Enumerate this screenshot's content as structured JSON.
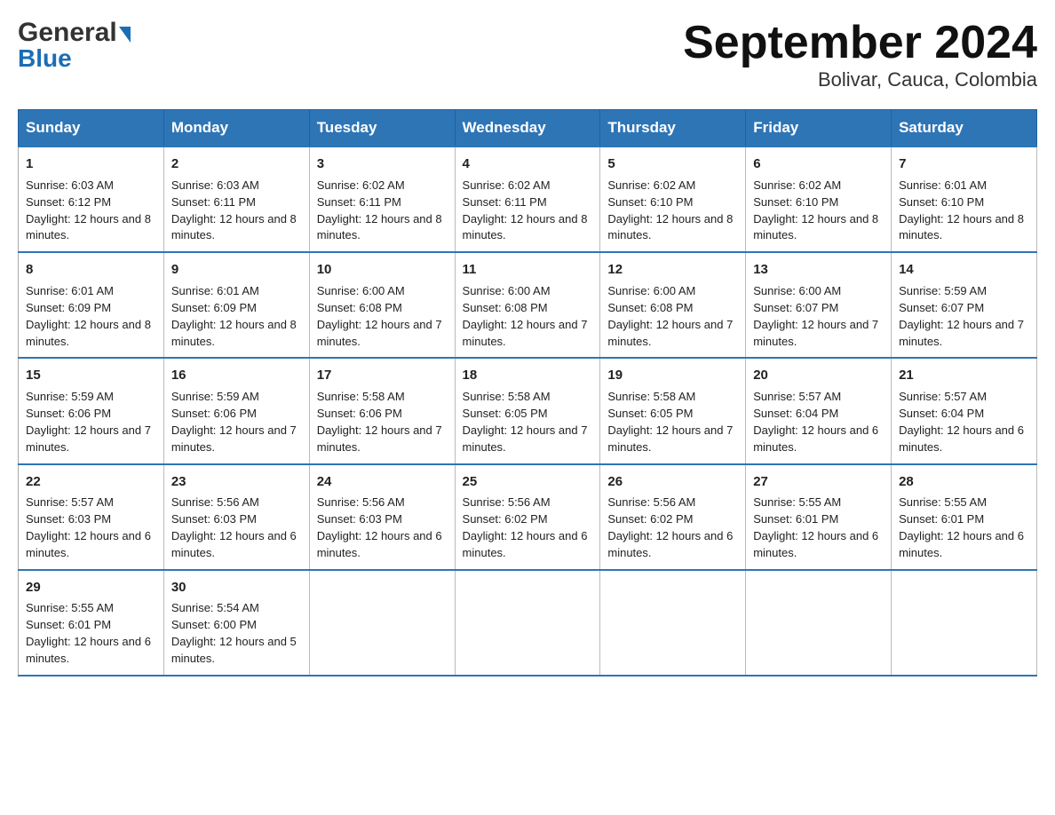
{
  "logo": {
    "general": "General",
    "blue": "Blue",
    "triangle": "▶"
  },
  "title": "September 2024",
  "subtitle": "Bolivar, Cauca, Colombia",
  "weekdays": [
    "Sunday",
    "Monday",
    "Tuesday",
    "Wednesday",
    "Thursday",
    "Friday",
    "Saturday"
  ],
  "weeks": [
    [
      {
        "day": "1",
        "sunrise": "6:03 AM",
        "sunset": "6:12 PM",
        "daylight": "12 hours and 8 minutes."
      },
      {
        "day": "2",
        "sunrise": "6:03 AM",
        "sunset": "6:11 PM",
        "daylight": "12 hours and 8 minutes."
      },
      {
        "day": "3",
        "sunrise": "6:02 AM",
        "sunset": "6:11 PM",
        "daylight": "12 hours and 8 minutes."
      },
      {
        "day": "4",
        "sunrise": "6:02 AM",
        "sunset": "6:11 PM",
        "daylight": "12 hours and 8 minutes."
      },
      {
        "day": "5",
        "sunrise": "6:02 AM",
        "sunset": "6:10 PM",
        "daylight": "12 hours and 8 minutes."
      },
      {
        "day": "6",
        "sunrise": "6:02 AM",
        "sunset": "6:10 PM",
        "daylight": "12 hours and 8 minutes."
      },
      {
        "day": "7",
        "sunrise": "6:01 AM",
        "sunset": "6:10 PM",
        "daylight": "12 hours and 8 minutes."
      }
    ],
    [
      {
        "day": "8",
        "sunrise": "6:01 AM",
        "sunset": "6:09 PM",
        "daylight": "12 hours and 8 minutes."
      },
      {
        "day": "9",
        "sunrise": "6:01 AM",
        "sunset": "6:09 PM",
        "daylight": "12 hours and 8 minutes."
      },
      {
        "day": "10",
        "sunrise": "6:00 AM",
        "sunset": "6:08 PM",
        "daylight": "12 hours and 7 minutes."
      },
      {
        "day": "11",
        "sunrise": "6:00 AM",
        "sunset": "6:08 PM",
        "daylight": "12 hours and 7 minutes."
      },
      {
        "day": "12",
        "sunrise": "6:00 AM",
        "sunset": "6:08 PM",
        "daylight": "12 hours and 7 minutes."
      },
      {
        "day": "13",
        "sunrise": "6:00 AM",
        "sunset": "6:07 PM",
        "daylight": "12 hours and 7 minutes."
      },
      {
        "day": "14",
        "sunrise": "5:59 AM",
        "sunset": "6:07 PM",
        "daylight": "12 hours and 7 minutes."
      }
    ],
    [
      {
        "day": "15",
        "sunrise": "5:59 AM",
        "sunset": "6:06 PM",
        "daylight": "12 hours and 7 minutes."
      },
      {
        "day": "16",
        "sunrise": "5:59 AM",
        "sunset": "6:06 PM",
        "daylight": "12 hours and 7 minutes."
      },
      {
        "day": "17",
        "sunrise": "5:58 AM",
        "sunset": "6:06 PM",
        "daylight": "12 hours and 7 minutes."
      },
      {
        "day": "18",
        "sunrise": "5:58 AM",
        "sunset": "6:05 PM",
        "daylight": "12 hours and 7 minutes."
      },
      {
        "day": "19",
        "sunrise": "5:58 AM",
        "sunset": "6:05 PM",
        "daylight": "12 hours and 7 minutes."
      },
      {
        "day": "20",
        "sunrise": "5:57 AM",
        "sunset": "6:04 PM",
        "daylight": "12 hours and 6 minutes."
      },
      {
        "day": "21",
        "sunrise": "5:57 AM",
        "sunset": "6:04 PM",
        "daylight": "12 hours and 6 minutes."
      }
    ],
    [
      {
        "day": "22",
        "sunrise": "5:57 AM",
        "sunset": "6:03 PM",
        "daylight": "12 hours and 6 minutes."
      },
      {
        "day": "23",
        "sunrise": "5:56 AM",
        "sunset": "6:03 PM",
        "daylight": "12 hours and 6 minutes."
      },
      {
        "day": "24",
        "sunrise": "5:56 AM",
        "sunset": "6:03 PM",
        "daylight": "12 hours and 6 minutes."
      },
      {
        "day": "25",
        "sunrise": "5:56 AM",
        "sunset": "6:02 PM",
        "daylight": "12 hours and 6 minutes."
      },
      {
        "day": "26",
        "sunrise": "5:56 AM",
        "sunset": "6:02 PM",
        "daylight": "12 hours and 6 minutes."
      },
      {
        "day": "27",
        "sunrise": "5:55 AM",
        "sunset": "6:01 PM",
        "daylight": "12 hours and 6 minutes."
      },
      {
        "day": "28",
        "sunrise": "5:55 AM",
        "sunset": "6:01 PM",
        "daylight": "12 hours and 6 minutes."
      }
    ],
    [
      {
        "day": "29",
        "sunrise": "5:55 AM",
        "sunset": "6:01 PM",
        "daylight": "12 hours and 6 minutes."
      },
      {
        "day": "30",
        "sunrise": "5:54 AM",
        "sunset": "6:00 PM",
        "daylight": "12 hours and 5 minutes."
      },
      null,
      null,
      null,
      null,
      null
    ]
  ]
}
